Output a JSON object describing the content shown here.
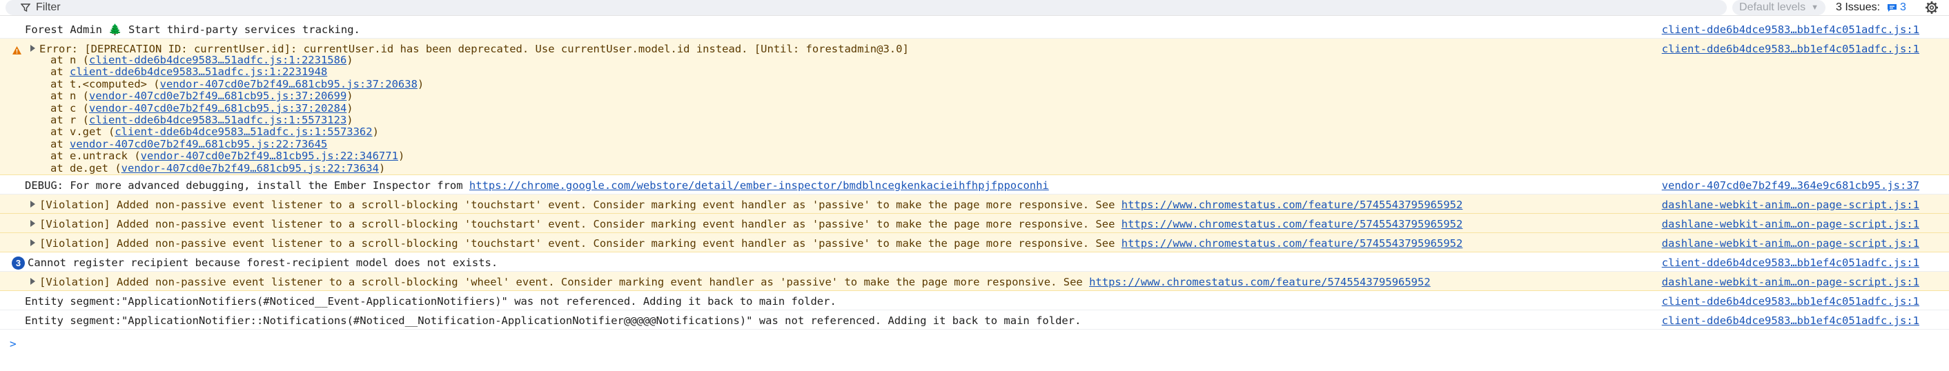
{
  "toolbar": {
    "filter_placeholder": "Filter",
    "levels_label": "Default levels",
    "issues_label": "3 Issues:",
    "issues_count": "3"
  },
  "rows": {
    "r0": {
      "message": "Forest Admin 🌲 Start third-party services tracking.",
      "source": "client-dde6b4dce9583…bb1ef4c051adfc.js:1"
    },
    "err": {
      "message": "Error: [DEPRECATION ID: currentUser.id]: currentUser.id has been deprecated. Use currentUser.model.id instead. [Until: forestadmin@3.0]",
      "source": "client-dde6b4dce9583…bb1ef4c051adfc.js:1",
      "stack": [
        {
          "prefix": "at n (",
          "link": "client-dde6b4dce9583…51adfc.js:1:2231586",
          "suffix": ")"
        },
        {
          "prefix": "at ",
          "link": "client-dde6b4dce9583…51adfc.js:1:2231948",
          "suffix": ""
        },
        {
          "prefix": "at t.<computed> (",
          "link": "vendor-407cd0e7b2f49…681cb95.js:37:20638",
          "suffix": ")"
        },
        {
          "prefix": "at n (",
          "link": "vendor-407cd0e7b2f49…681cb95.js:37:20699",
          "suffix": ")"
        },
        {
          "prefix": "at c (",
          "link": "vendor-407cd0e7b2f49…681cb95.js:37:20284",
          "suffix": ")"
        },
        {
          "prefix": "at r (",
          "link": "client-dde6b4dce9583…51adfc.js:1:5573123",
          "suffix": ")"
        },
        {
          "prefix": "at v.get (",
          "link": "client-dde6b4dce9583…51adfc.js:1:5573362",
          "suffix": ")"
        },
        {
          "prefix": "at ",
          "link": "vendor-407cd0e7b2f49…681cb95.js:22:73645",
          "suffix": ""
        },
        {
          "prefix": "at e.untrack (",
          "link": "vendor-407cd0e7b2f49…81cb95.js:22:346771",
          "suffix": ")"
        },
        {
          "prefix": "at de.get (",
          "link": "vendor-407cd0e7b2f49…681cb95.js:22:73634",
          "suffix": ")"
        }
      ]
    },
    "debug": {
      "message": "DEBUG: For more advanced debugging, install the Ember Inspector from ",
      "link": "https://chrome.google.com/webstore/detail/ember-inspector/bmdblncegkenkacieihfhpjfppoconhi",
      "source": "vendor-407cd0e7b2f49…364e9c681cb95.js:37"
    },
    "v1": {
      "message": "[Violation] Added non-passive event listener to a scroll-blocking 'touchstart' event. Consider marking event handler as 'passive' to make the page more responsive. See ",
      "link": "https://www.chromestatus.com/feature/5745543795965952",
      "source": "dashlane-webkit-anim…on-page-script.js:1"
    },
    "v2": {
      "message": "[Violation] Added non-passive event listener to a scroll-blocking 'touchstart' event. Consider marking event handler as 'passive' to make the page more responsive. See ",
      "link": "https://www.chromestatus.com/feature/5745543795965952",
      "source": "dashlane-webkit-anim…on-page-script.js:1"
    },
    "v3": {
      "message": "[Violation] Added non-passive event listener to a scroll-blocking 'touchstart' event. Consider marking event handler as 'passive' to make the page more responsive. See ",
      "link": "https://www.chromestatus.com/feature/5745543795965952",
      "source": "dashlane-webkit-anim…on-page-script.js:1"
    },
    "rec": {
      "badge": "3",
      "message": "Cannot register recipient because forest-recipient model does not exists.",
      "source": "client-dde6b4dce9583…bb1ef4c051adfc.js:1"
    },
    "v4": {
      "message": "[Violation] Added non-passive event listener to a scroll-blocking 'wheel' event. Consider marking event handler as 'passive' to make the page more responsive. See ",
      "link": "https://www.chromestatus.com/feature/5745543795965952",
      "source": "dashlane-webkit-anim…on-page-script.js:1"
    },
    "e1": {
      "message": "Entity segment:\"ApplicationNotifiers(#Noticed__Event-ApplicationNotifiers)\" was not referenced. Adding it back to main folder.",
      "source": "client-dde6b4dce9583…bb1ef4c051adfc.js:1"
    },
    "e2": {
      "message": "Entity segment:\"ApplicationNotifier::Notifications(#Noticed__Notification-ApplicationNotifier@@@@@Notifications)\" was not referenced. Adding it back to main folder.",
      "source": "client-dde6b4dce9583…bb1ef4c051adfc.js:1"
    }
  },
  "prompt": ">"
}
